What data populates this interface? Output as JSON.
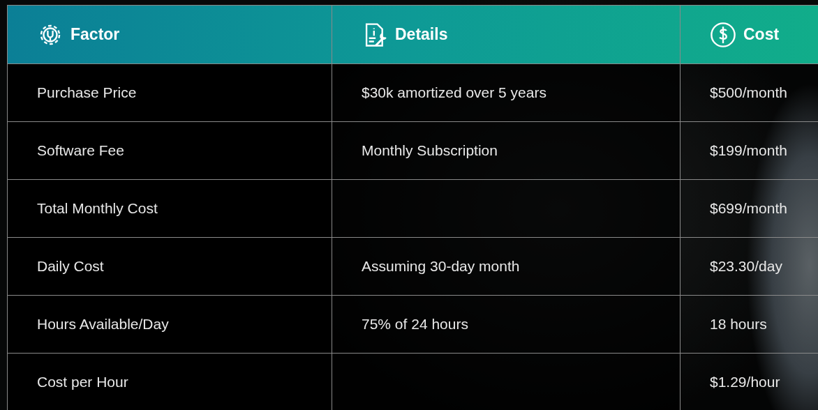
{
  "table": {
    "columns": [
      {
        "label": "Factor"
      },
      {
        "label": "Details"
      },
      {
        "label": "Cost"
      }
    ],
    "rows": [
      {
        "cells": [
          "Purchase Price",
          "$30k amortized over 5 years",
          "$500/month"
        ]
      },
      {
        "cells": [
          "Software Fee",
          "Monthly Subscription",
          "$199/month"
        ]
      },
      {
        "cells": [
          "Total Monthly Cost",
          "",
          "$699/month"
        ]
      },
      {
        "cells": [
          "Daily Cost",
          "Assuming 30-day month",
          "$23.30/day"
        ]
      },
      {
        "cells": [
          "Hours Available/Day",
          "75% of 24 hours",
          "18 hours"
        ]
      },
      {
        "cells": [
          "Cost per Hour",
          "",
          "$1.29/hour"
        ]
      }
    ]
  }
}
